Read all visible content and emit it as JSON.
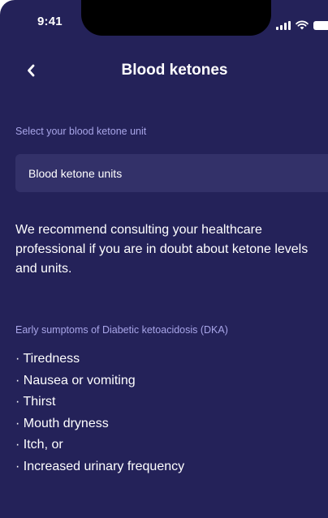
{
  "status_bar": {
    "time": "9:41",
    "icons": [
      "cellular-signal-icon",
      "wifi-icon",
      "battery-icon"
    ]
  },
  "header": {
    "back_icon": "chevron-left-icon",
    "title": "Blood ketones"
  },
  "unit_section": {
    "label": "Select your blood ketone unit",
    "select_value": "Blood ketone units"
  },
  "info": {
    "text": "We recommend consulting your healthcare professional if you are in doubt about ketone levels and units."
  },
  "dka_section": {
    "label": "Early sumptoms of Diabetic ketoacidosis (DKA)",
    "items": [
      "Tiredness",
      "Nausea or vomiting",
      "Thirst",
      "Mouth dryness",
      "Itch, or",
      "Increased urinary frequency"
    ]
  },
  "colors": {
    "background": "#242259",
    "field": "#333169",
    "label_accent": "#a8a5e8",
    "text": "#ffffff"
  }
}
